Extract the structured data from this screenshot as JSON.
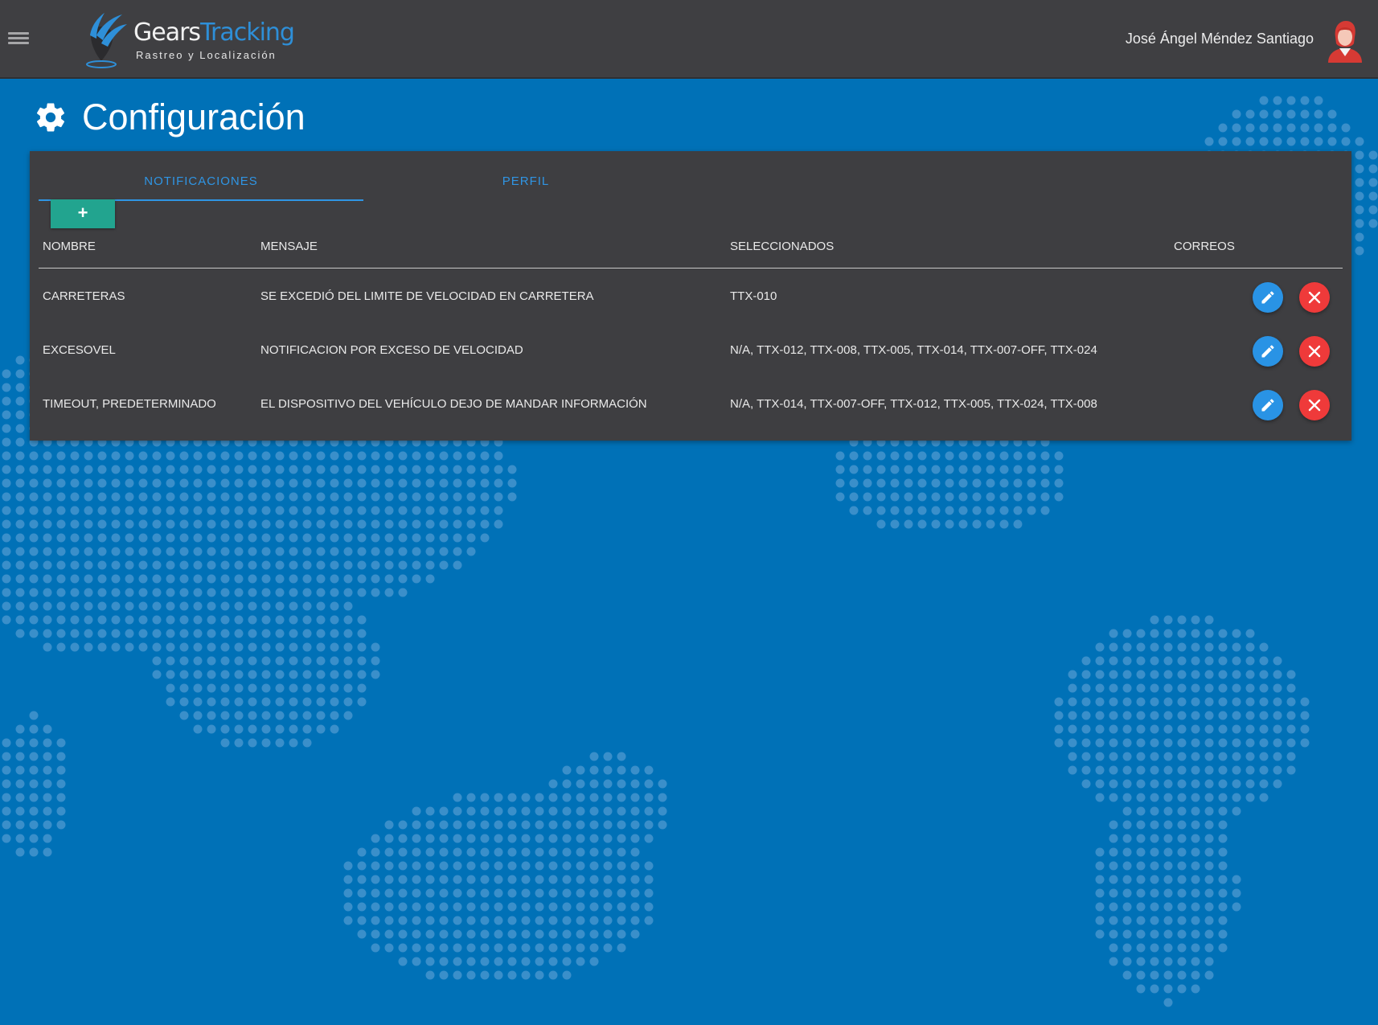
{
  "header": {
    "logo_part1": "Gears",
    "logo_part2": "Tracking",
    "logo_subtitle": "Rastreo y Localización",
    "user_name": "José Ángel Méndez Santiago"
  },
  "page": {
    "title": "Configuración"
  },
  "tabs": [
    {
      "label": "NOTIFICACIONES",
      "active": true
    },
    {
      "label": "PERFIL",
      "active": false
    }
  ],
  "add_button_label": "+",
  "table": {
    "columns": [
      "NOMBRE",
      "MENSAJE",
      "SELECCIONADOS",
      "CORREOS"
    ],
    "rows": [
      {
        "nombre": "CARRETERAS",
        "mensaje": "SE EXCEDIÓ DEL LIMITE DE VELOCIDAD EN CARRETERA",
        "seleccionados": "TTX-010",
        "correos": ""
      },
      {
        "nombre": "EXCESOVEL",
        "mensaje": "NOTIFICACION POR EXCESO DE VELOCIDAD",
        "seleccionados": "N/A, TTX-012, TTX-008, TTX-005, TTX-014, TTX-007-OFF, TTX-024",
        "correos": ""
      },
      {
        "nombre": "TIMEOUT, PREDETERMINADO",
        "mensaje": "EL DISPOSITIVO DEL VEHÍCULO DEJO DE MANDAR INFORMACIÓN",
        "seleccionados": "N/A, TTX-014, TTX-007-OFF, TTX-012, TTX-005, TTX-024, TTX-008",
        "correos": ""
      }
    ]
  },
  "icons": {
    "menu": "hamburger-menu-icon",
    "settings": "gear-icon",
    "edit": "pencil-icon",
    "delete": "close-icon",
    "avatar": "user-avatar"
  },
  "colors": {
    "header_bg": "#3f3f42",
    "page_bg": "#0071b7",
    "panel_bg": "#3e3e41",
    "accent_blue": "#2f95e4",
    "add_green": "#22a48f",
    "delete_red": "#ef3a3a"
  }
}
